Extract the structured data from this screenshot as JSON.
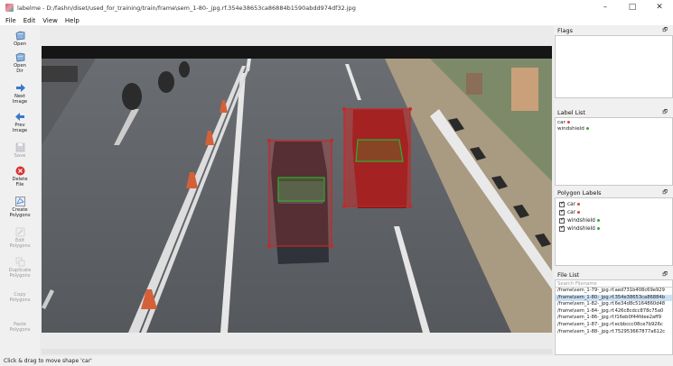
{
  "window": {
    "title": "labelme - D:/fashn/diset/used_for_training/train/frame\\sem_1-80-_jpg.rf.354e38653ca86884b1590abdd974df32.jpg",
    "minimize": "–",
    "maximize": "□",
    "close": "✕"
  },
  "menu": [
    "File",
    "Edit",
    "View",
    "Help"
  ],
  "toolbar": {
    "open": "Open",
    "open_dir": "Open\nDir",
    "next_image": "Next\nImage",
    "prev_image": "Prev\nImage",
    "save": "Save",
    "delete_file": "Delete\nFile",
    "create_polygons": "Create\nPolygons",
    "edit_polygons": "Edit\nPolygons",
    "duplicate_polygons": "Duplicate\nPolygons",
    "copy_polygons": "Copy\nPolygons",
    "paste_polygons": "Paste\nPolygons"
  },
  "docks": {
    "flags": {
      "title": "Flags"
    },
    "label_list": {
      "title": "Label List",
      "items": [
        {
          "label": "car",
          "color": "#d94545"
        },
        {
          "label": "windshield",
          "color": "#2fae2f"
        }
      ]
    },
    "polygon_labels": {
      "title": "Polygon Labels",
      "items": [
        {
          "label": "car",
          "color": "#d94545"
        },
        {
          "label": "car",
          "color": "#d94545"
        },
        {
          "label": "windshield",
          "color": "#2fae2f"
        },
        {
          "label": "windshield",
          "color": "#2fae2f"
        }
      ]
    },
    "file_list": {
      "title": "File List",
      "search_placeholder": "Search Filename",
      "files": [
        "/frame\\sem_1-79-_jpg.rf.aed731b408c69e929",
        "/frame\\sem_1-80-_jpg.rf.354e38653ca86884b",
        "/frame\\sem_1-82-_jpg.rf.6e34d8c5164860d48",
        "/frame\\sem_1-84-_jpg.rf.426c8cdcc878c75a0",
        "/frame\\sem_1-86-_jpg.rf.f16eb0f44fdee2aff9",
        "/frame\\sem_1-87-_jpg.rf.ecbbccc08ce7b926c",
        "/frame\\sem_1-88-_jpg.rf.752953667877a612c"
      ],
      "selected_index": 1
    }
  },
  "float_glyph": "🗗",
  "status": "Click & drag to move shape 'car'",
  "colors": {
    "car_label": "#c62828",
    "windshield_label": "#2fae2f",
    "selection": "#cde1f5"
  }
}
